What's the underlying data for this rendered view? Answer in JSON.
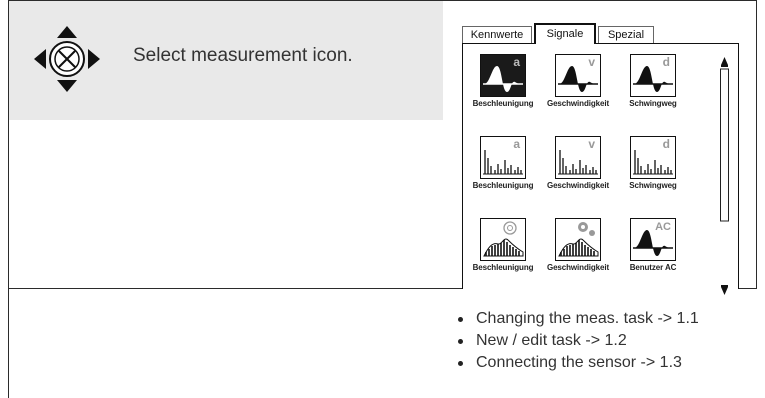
{
  "instruction": "Select measurement icon.",
  "tabs": [
    {
      "label": "Kennwerte",
      "active": false
    },
    {
      "label": "Signale",
      "active": true
    },
    {
      "label": "Spezial",
      "active": false
    }
  ],
  "icons": [
    {
      "label": "Beschleunigung",
      "letter": "a",
      "kind": "wave",
      "selected": true
    },
    {
      "label": "Geschwindigkeit",
      "letter": "v",
      "kind": "wave",
      "selected": false
    },
    {
      "label": "Schwingweg",
      "letter": "d",
      "kind": "wave",
      "selected": false
    },
    {
      "label": "Beschleunigung",
      "letter": "a",
      "kind": "spectrum",
      "selected": false
    },
    {
      "label": "Geschwindigkeit",
      "letter": "v",
      "kind": "spectrum",
      "selected": false
    },
    {
      "label": "Schwingweg",
      "letter": "d",
      "kind": "spectrum",
      "selected": false
    },
    {
      "label": "Beschleunigung",
      "letter": "",
      "kind": "bearing",
      "selected": false
    },
    {
      "label": "Geschwindigkeit",
      "letter": "",
      "kind": "gear",
      "selected": false
    },
    {
      "label": "Benutzer AC",
      "letter": "AC",
      "kind": "wave",
      "selected": false
    }
  ],
  "bullets": [
    "Changing the meas. task -> 1.1",
    "New / edit task -> 1.2",
    "Connecting the sensor -> 1.3"
  ],
  "colors": {
    "instruction_bg": "#e9e9e9",
    "selected_icon_bg": "#1a1a1a"
  },
  "icon_names": {
    "navigation": "navigation-pad-icon",
    "scroll_up": "scroll-up-arrow-icon",
    "scroll_down": "scroll-down-arrow-icon"
  }
}
